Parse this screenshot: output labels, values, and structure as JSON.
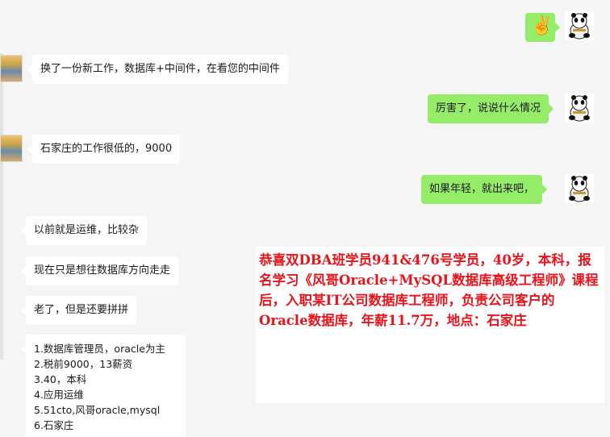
{
  "messages": [
    {
      "side": "right",
      "kind": "emoji",
      "emoji": "✌️"
    },
    {
      "side": "left",
      "text": "换了一份新工作，数据库+中间件，在看您的中间件"
    },
    {
      "side": "right",
      "text": "厉害了，说说什么情况"
    },
    {
      "side": "left",
      "text": "石家庄的工作很低的，9000"
    },
    {
      "side": "right",
      "text": "如果年轻，就出来吧，"
    },
    {
      "side": "left",
      "text": "以前就是运维，比较杂"
    },
    {
      "side": "left",
      "text": "现在只是想往数据库方向走走"
    },
    {
      "side": "left",
      "text": "老了，但是还要拼拼"
    }
  ],
  "list_message": {
    "items": [
      "1.数据库管理员，oracle为主",
      "2.税前9000，13薪资",
      "3.40，本科",
      "4.应用运维",
      "5.51cto,风哥oracle,mysql",
      "6.石家庄"
    ]
  },
  "overlay": {
    "text": "恭喜双DBA班学员941&476号学员，40岁，本科，报名学习《风哥Oracle+MySQL数据库高级工程师》课程后，入职某IT公司数据库工程师，负责公司客户的Oracle数据库，年薪11.7万，地点：石家庄",
    "color": "#e8141b"
  },
  "icons": {
    "right_avatar": "panda-avatar-icon",
    "left_avatar": "user-avatar-icon"
  }
}
